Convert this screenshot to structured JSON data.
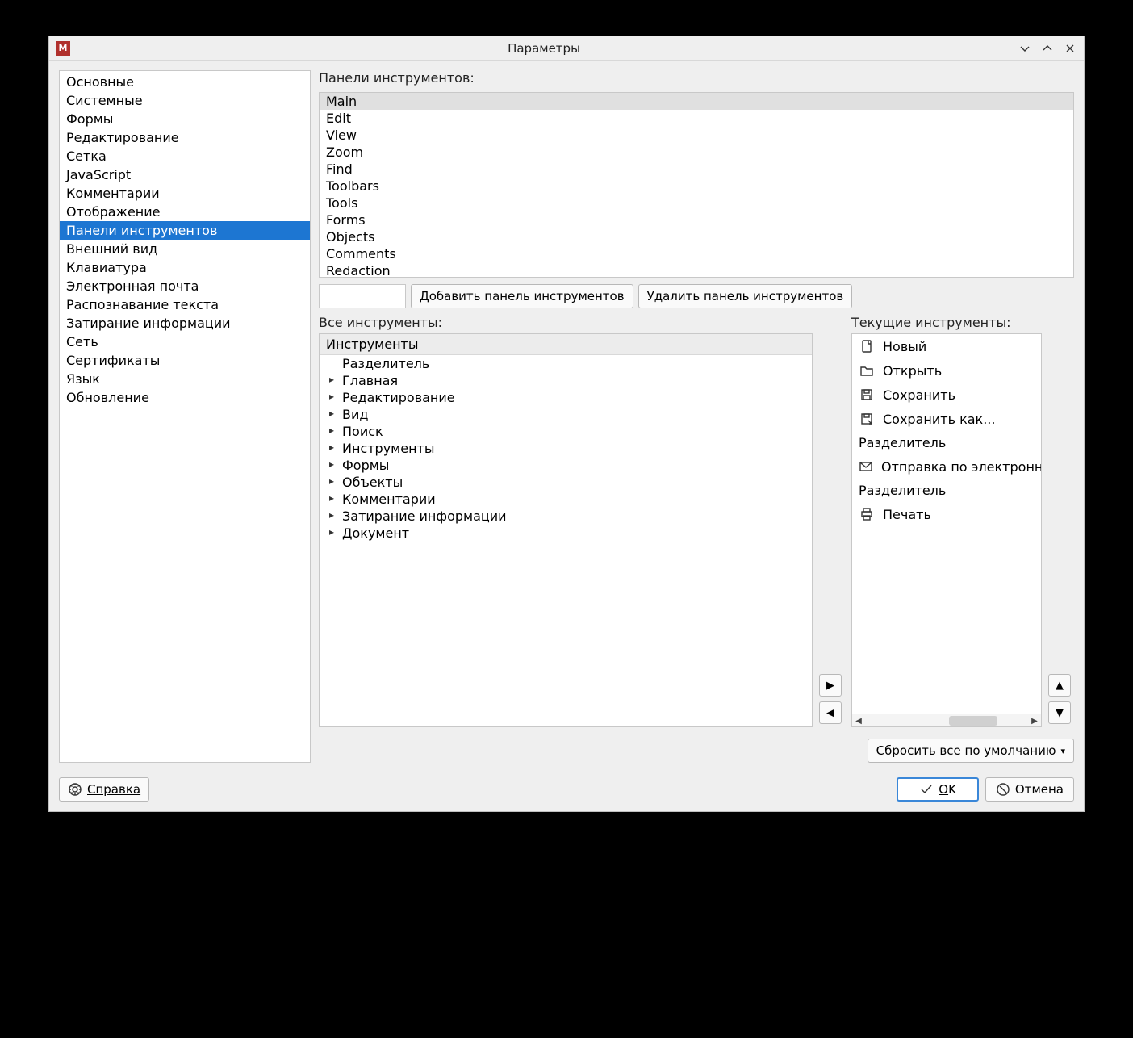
{
  "window": {
    "title": "Параметры"
  },
  "sidebar": [
    "Основные",
    "Системные",
    "Формы",
    "Редактирование",
    "Сетка",
    "JavaScript",
    "Комментарии",
    "Отображение",
    "Панели инструментов",
    "Внешний вид",
    "Клавиатура",
    "Электронная почта",
    "Распознавание текста",
    "Затирание информации",
    "Сеть",
    "Сертификаты",
    "Язык",
    "Обновление"
  ],
  "sidebar_selected_index": 8,
  "labels": {
    "toolbars": "Панели инструментов:",
    "add_toolbar": "Добавить панель инструментов",
    "remove_toolbar": "Удалить панель инструментов",
    "all_tools": "Все инструменты:",
    "current_tools": "Текущие инструменты:",
    "tree_header": "Инструменты",
    "reset_all": "Сбросить все по умолчанию",
    "help": "Справка",
    "ok": "OK",
    "cancel": "Отмена"
  },
  "toolbar_list": [
    "Main",
    "Edit",
    "View",
    "Zoom",
    "Find",
    "Toolbars",
    "Tools",
    "Forms",
    "Objects",
    "Comments",
    "Redaction"
  ],
  "toolbar_selected_index": 0,
  "new_toolbar_name": "",
  "tree": [
    {
      "label": "Разделитель",
      "expandable": false
    },
    {
      "label": "Главная",
      "expandable": true
    },
    {
      "label": "Редактирование",
      "expandable": true
    },
    {
      "label": "Вид",
      "expandable": true
    },
    {
      "label": "Поиск",
      "expandable": true
    },
    {
      "label": "Инструменты",
      "expandable": true
    },
    {
      "label": "Формы",
      "expandable": true
    },
    {
      "label": "Объекты",
      "expandable": true
    },
    {
      "label": "Комментарии",
      "expandable": true
    },
    {
      "label": "Затирание информации",
      "expandable": true
    },
    {
      "label": "Документ",
      "expandable": true
    }
  ],
  "current": [
    {
      "icon": "new",
      "label": "Новый"
    },
    {
      "icon": "open",
      "label": "Открыть"
    },
    {
      "icon": "save",
      "label": "Сохранить"
    },
    {
      "icon": "saveas",
      "label": "Сохранить как..."
    },
    {
      "icon": "sep",
      "label": "Разделитель"
    },
    {
      "icon": "mail",
      "label": "Отправка по электронной почте"
    },
    {
      "icon": "sep",
      "label": "Разделитель"
    },
    {
      "icon": "print",
      "label": "Печать"
    }
  ]
}
